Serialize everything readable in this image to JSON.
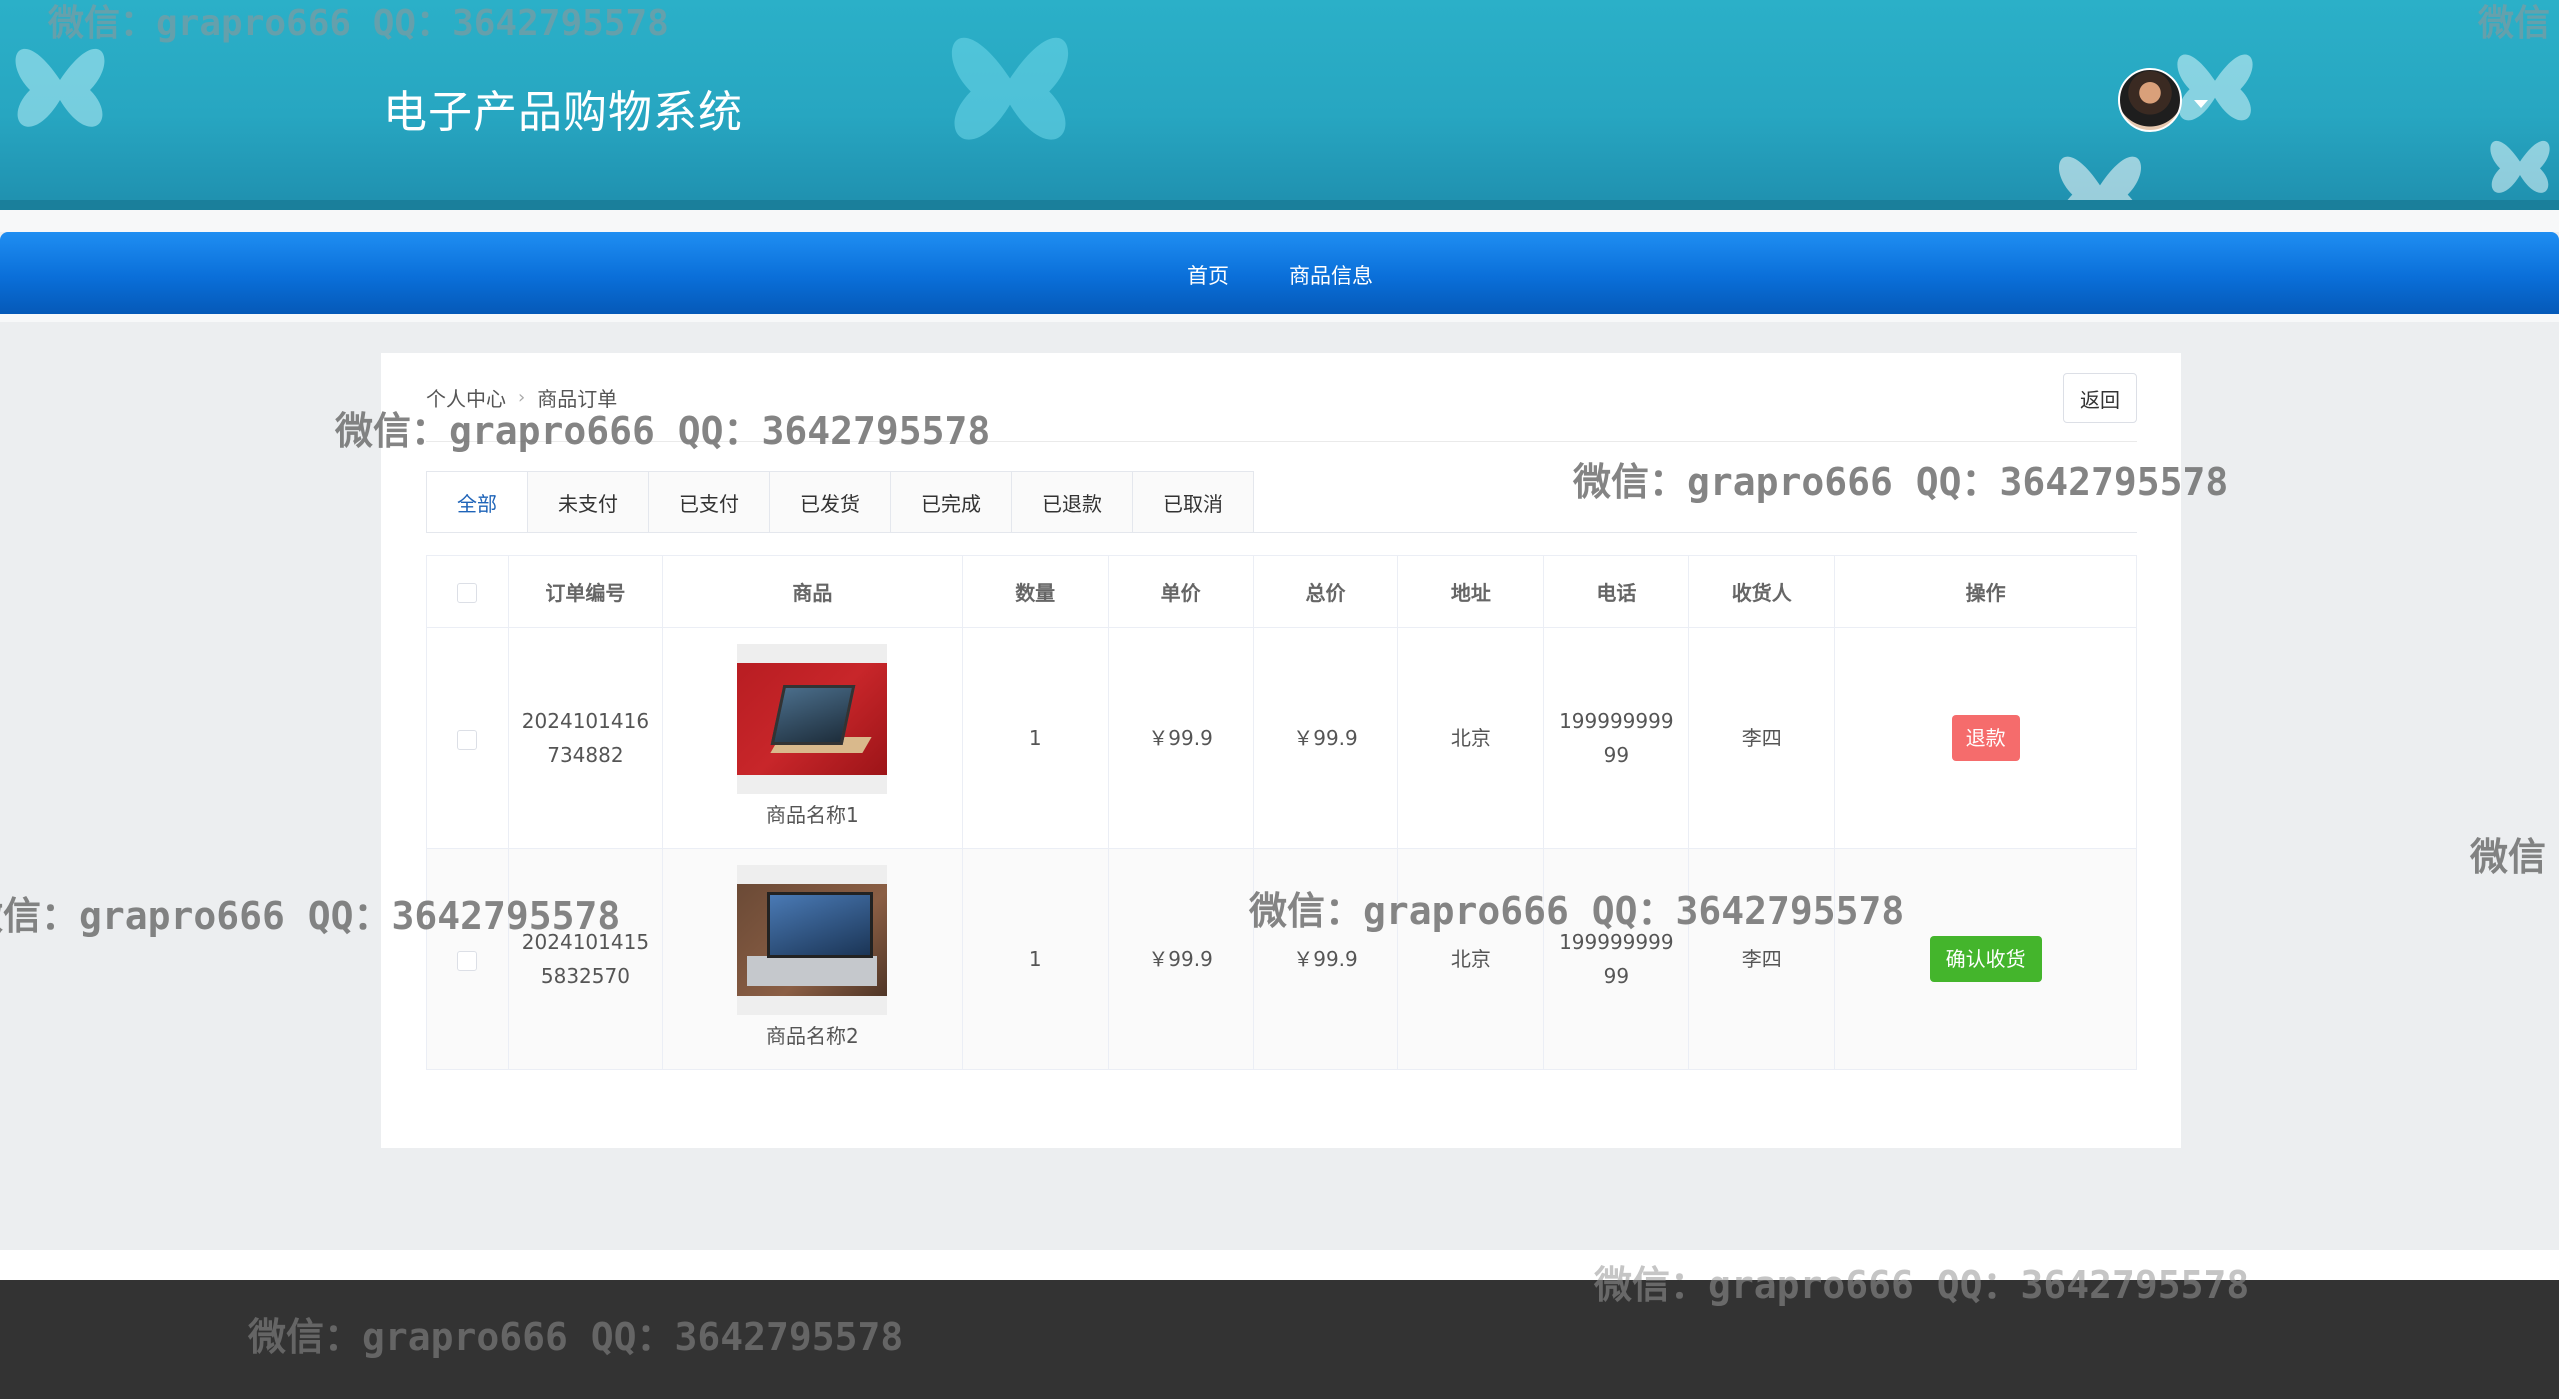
{
  "header": {
    "title": "电子产品购物系统",
    "avatar_icon": "user-avatar"
  },
  "nav": {
    "items": [
      "首页",
      "商品信息"
    ]
  },
  "breadcrumb": {
    "items": [
      "个人中心",
      "商品订单"
    ],
    "separator": "›"
  },
  "back_label": "返回",
  "tabs": [
    "全部",
    "未支付",
    "已支付",
    "已发货",
    "已完成",
    "已退款",
    "已取消"
  ],
  "active_tab": "全部",
  "table": {
    "headers": [
      "订单编号",
      "商品",
      "数量",
      "单价",
      "总价",
      "地址",
      "电话",
      "收货人",
      "操作"
    ],
    "rows": [
      {
        "order_no_1": "2024101416",
        "order_no_2": "734882",
        "product": "商品名称1",
        "qty": "1",
        "unit_price": "￥99.9",
        "total": "￥99.9",
        "address": "北京",
        "phone_1": "199999999",
        "phone_2": "99",
        "receiver": "李四",
        "action": "退款"
      },
      {
        "order_no_1": "2024101415",
        "order_no_2": "5832570",
        "product": "商品名称2",
        "qty": "1",
        "unit_price": "￥99.9",
        "total": "￥99.9",
        "address": "北京",
        "phone_1": "199999999",
        "phone_2": "99",
        "receiver": "李四",
        "action": "确认收货"
      }
    ]
  },
  "watermark": "微信：grapro666 QQ：3642795578",
  "watermark_short": "微信",
  "colors": {
    "header": "#27a6c1",
    "nav": "#0a6fd9",
    "refund": "#f56c6c",
    "confirm": "#44b52c",
    "active_tab": "#1e63b8",
    "footer": "#333333"
  }
}
